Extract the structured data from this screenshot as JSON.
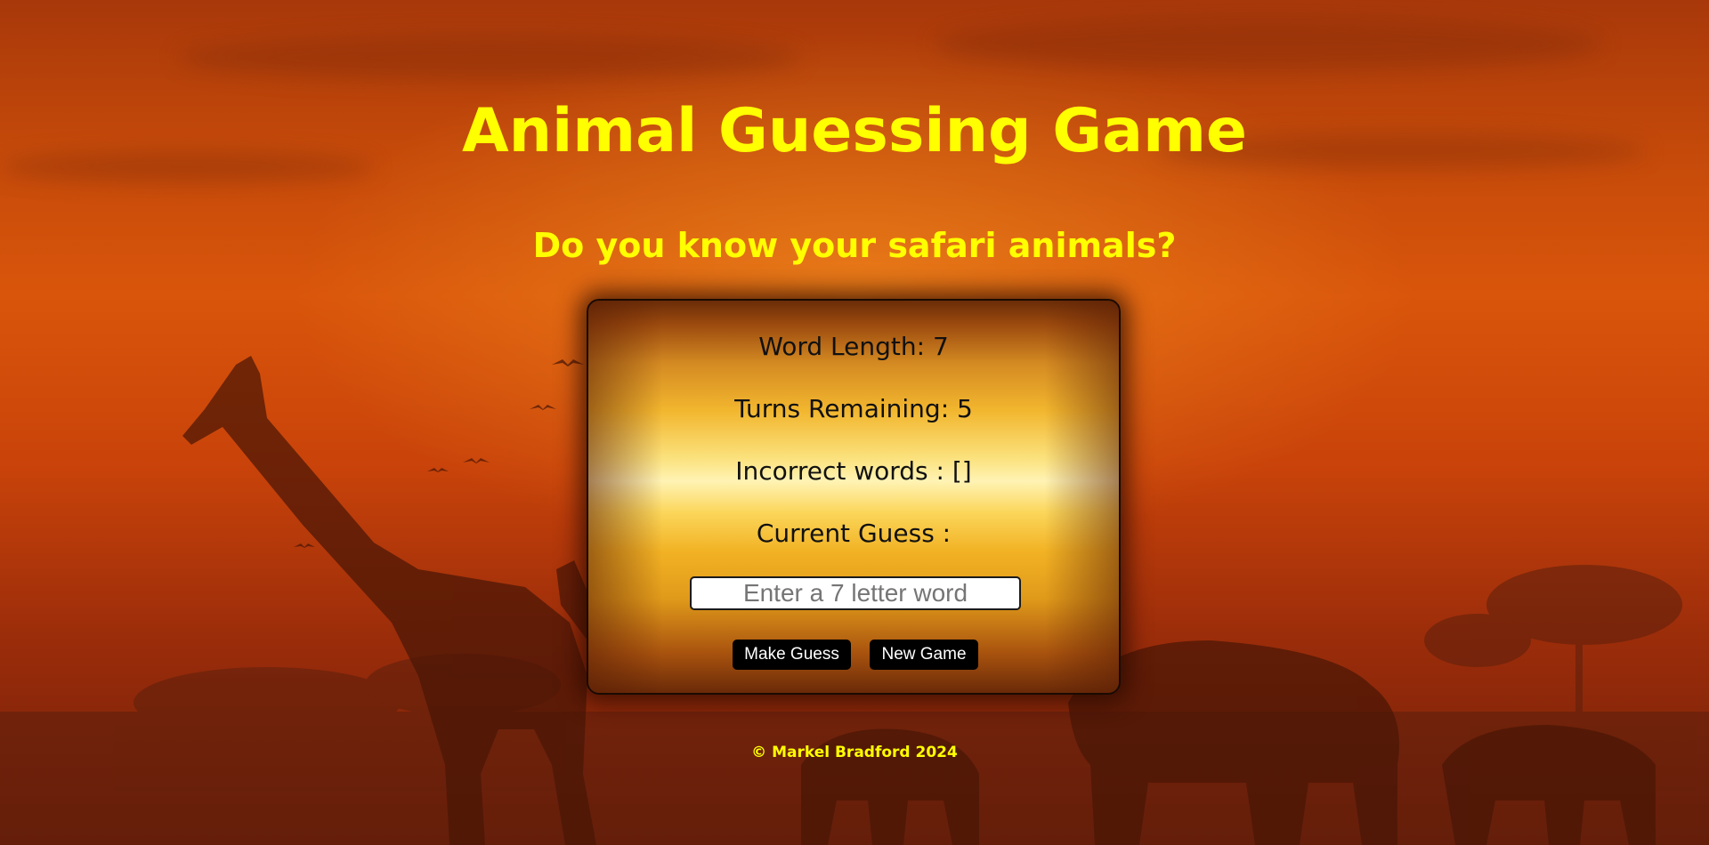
{
  "page": {
    "title": "Animal Guessing Game",
    "subtitle": "Do you know your safari animals?"
  },
  "game": {
    "word_length": "Word Length: 7",
    "turns_remaining": "Turns Remaining: 5",
    "incorrect_words": "Incorrect words : []",
    "current_guess": "Current Guess :",
    "guess_input": {
      "value": "",
      "placeholder": "Enter a 7 letter word"
    },
    "make_guess_label": "Make Guess",
    "new_game_label": "New Game"
  },
  "footer": {
    "copyright": "© Markel Bradford 2024"
  },
  "colors": {
    "heading": "#ffff00",
    "button_bg": "#000000",
    "button_text": "#ffffff",
    "card_text": "#111111"
  },
  "icons": {
    "background": "safari-sunset-silhouette-icon"
  }
}
